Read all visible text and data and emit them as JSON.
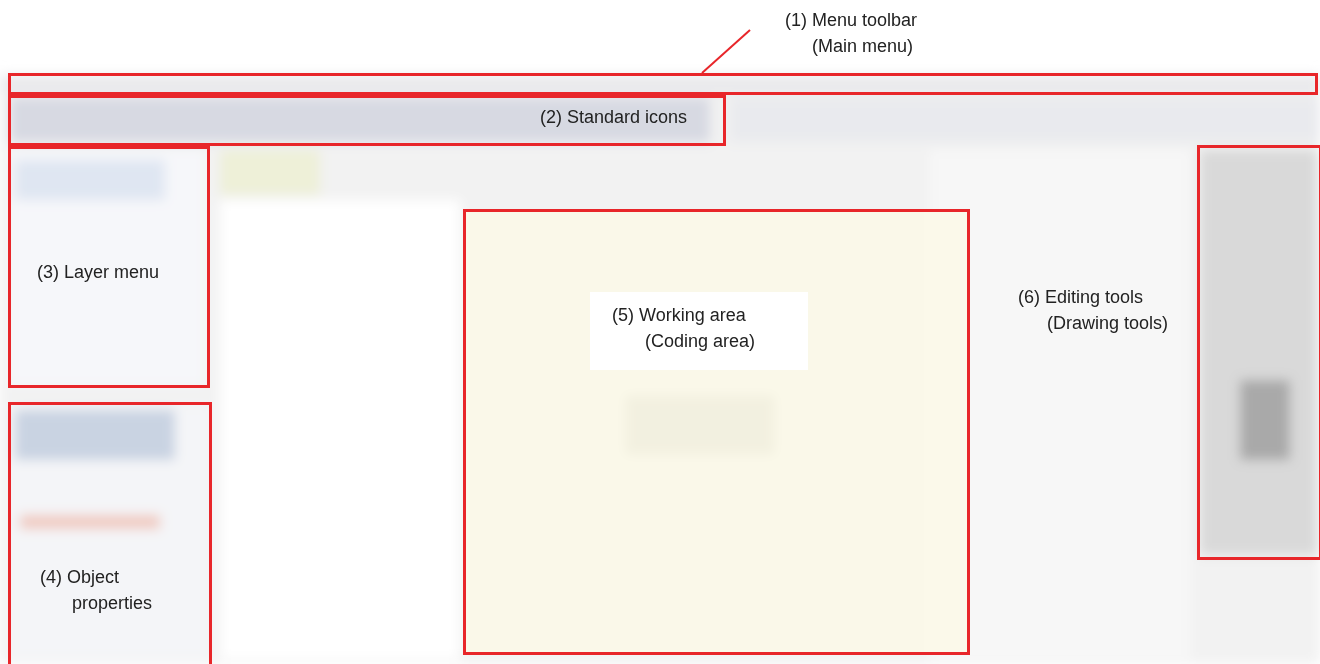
{
  "callouts": [
    {
      "kind": "leader",
      "lines": [
        "(1) Menu toolbar",
        "(Main menu)"
      ]
    },
    {
      "kind": "inside",
      "lines": [
        "(2) Standard icons"
      ]
    },
    {
      "kind": "inside",
      "lines": [
        "(3) Layer menu"
      ]
    },
    {
      "kind": "inside",
      "lines": [
        "(4) Object",
        "properties"
      ]
    },
    {
      "kind": "plate",
      "lines": [
        "(5) Working area",
        "(Coding area)"
      ]
    },
    {
      "kind": "inside",
      "lines": [
        "(6) Editing tools",
        "(Drawing tools)"
      ]
    }
  ]
}
